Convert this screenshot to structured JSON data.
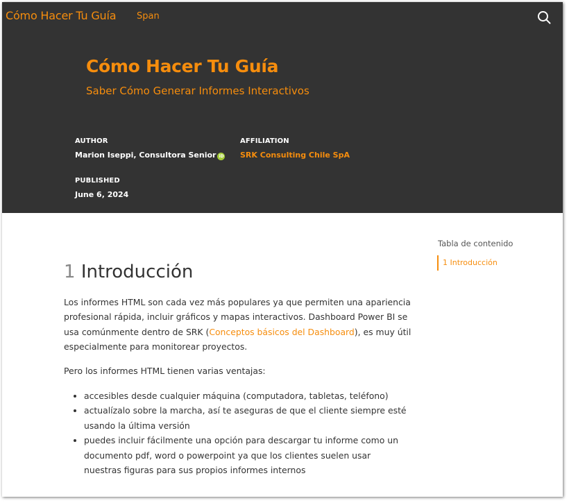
{
  "navbar": {
    "brand": "Cómo Hacer Tu Guía",
    "links": [
      "Span"
    ],
    "search_icon": "search-icon"
  },
  "header": {
    "title": "Cómo Hacer Tu Guía",
    "subtitle": "Saber Cómo Generar Informes Interactivos",
    "author_label": "AUTHOR",
    "author": "Marion Iseppi, Consultora Senior",
    "orcid_icon": "orcid-icon",
    "orcid_text": "iD",
    "affiliation_label": "AFFILIATION",
    "affiliation": "SRK Consulting Chile SpA",
    "published_label": "PUBLISHED",
    "published": "June 6, 2024"
  },
  "toc": {
    "title": "Tabla de contenido",
    "items": [
      "1 Introducción"
    ]
  },
  "section": {
    "number": "1",
    "heading": "Introducción",
    "p1_before": "Los informes HTML son cada vez más populares ya que permiten una apariencia profesional rápida, incluir gráficos y mapas interactivos. Dashboard Power BI se usa comúnmente dentro de SRK (",
    "p1_link": "Conceptos básicos del Dashboard",
    "p1_after": "), es muy útil especialmente para monitorear proyectos.",
    "p2": "Pero los informes HTML tienen varias ventajas:",
    "bullets": [
      "accesibles desde cualquier máquina (computadora, tabletas, teléfono)",
      "actualízalo sobre la marcha, así te aseguras de que el cliente siempre esté usando la última versión",
      "puedes incluir fácilmente una opción para descargar tu informe como un documento pdf, word o powerpoint ya que los clientes suelen usar nuestras figuras para sus propios informes internos"
    ]
  },
  "colors": {
    "accent": "#f68d0d",
    "header_bg": "#333333",
    "text": "#333333",
    "orcid": "#a6ce39"
  }
}
